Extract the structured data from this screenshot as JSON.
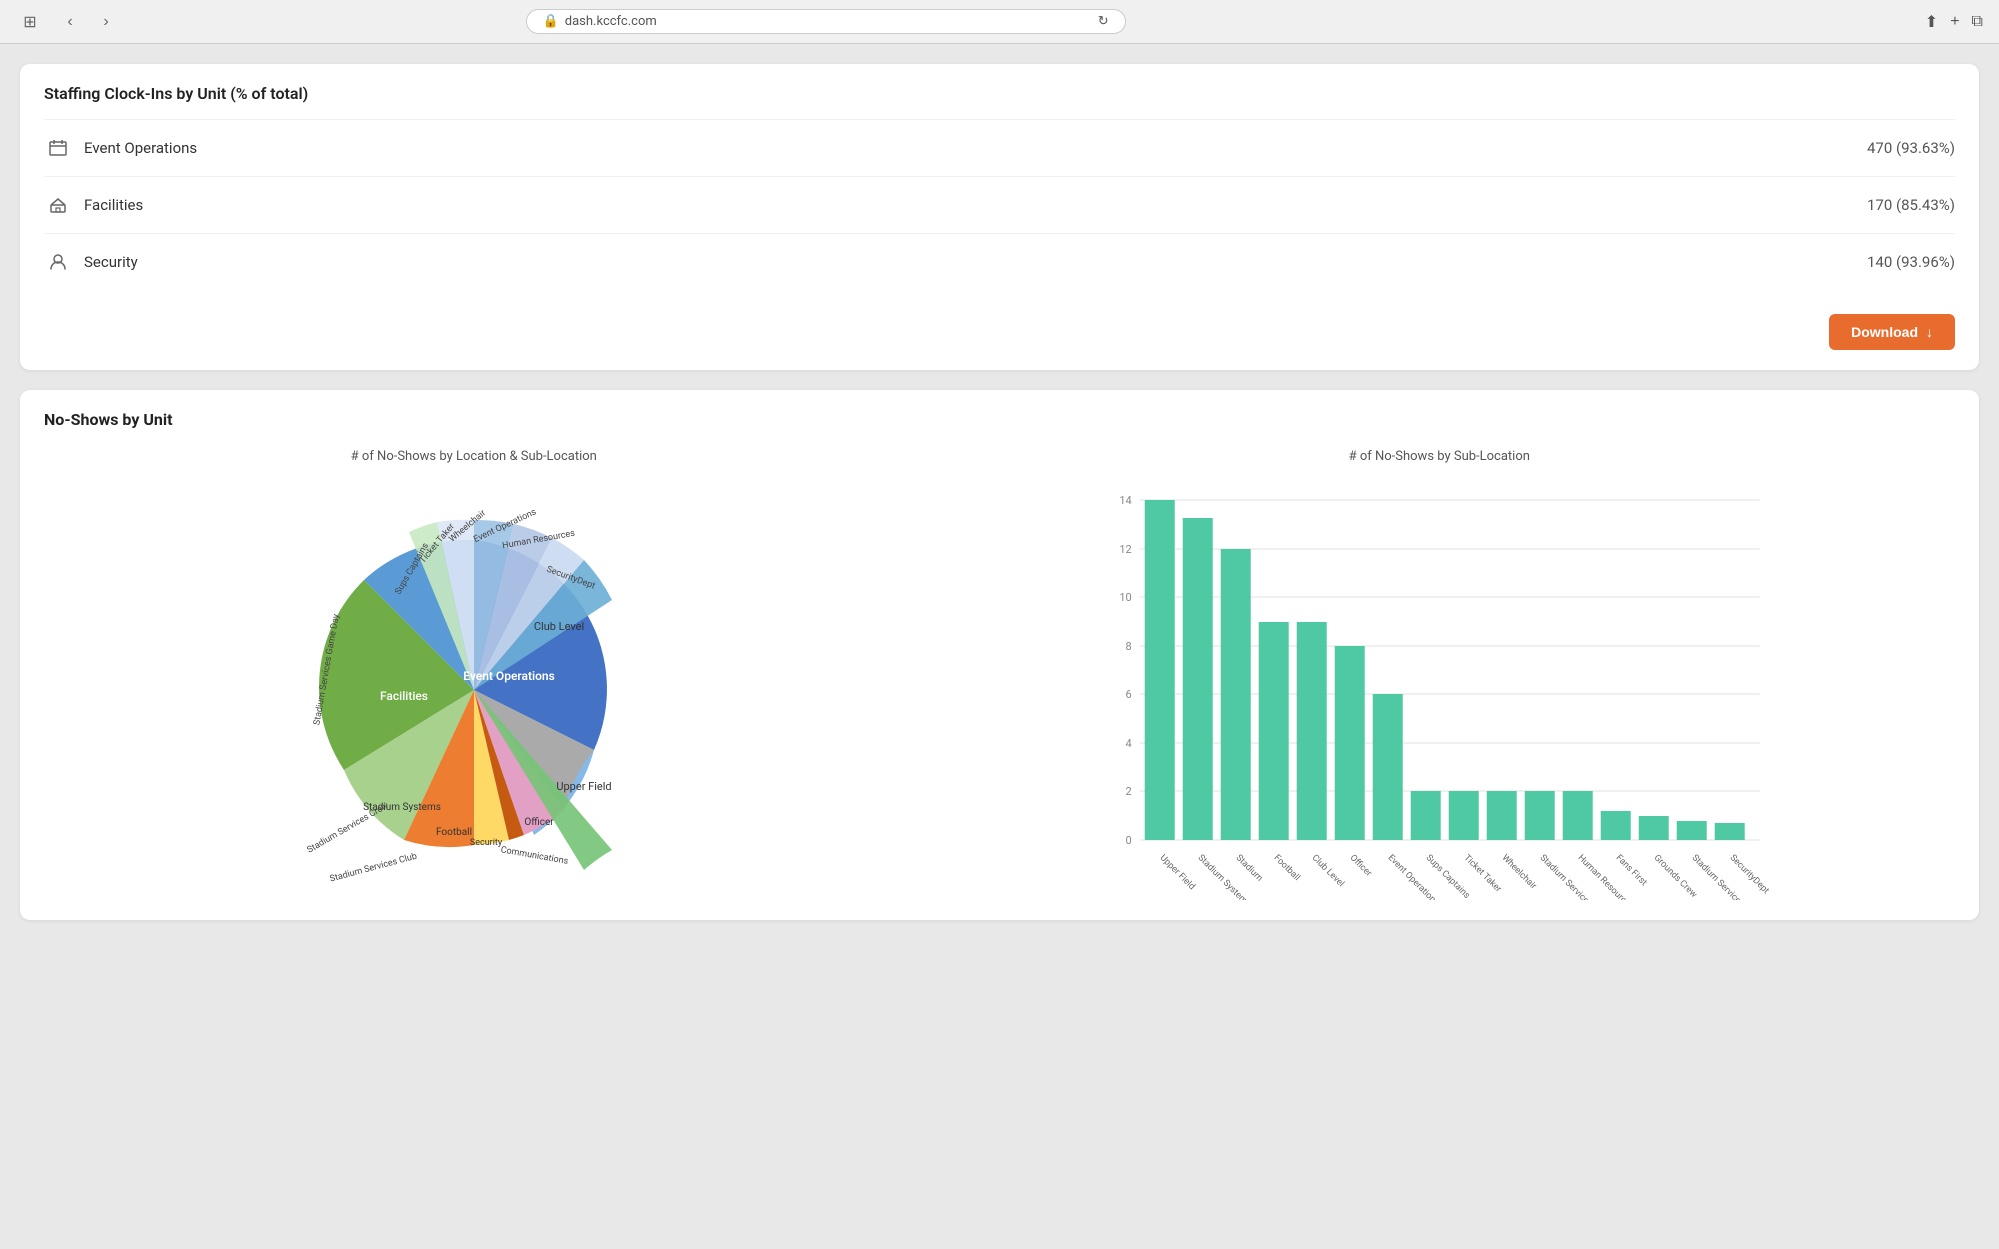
{
  "browser": {
    "url": "dash.kccfc.com",
    "lock_icon": "🔒",
    "reload_icon": "↻",
    "share_icon": "⬆",
    "new_tab_icon": "+",
    "windows_icon": "⧉",
    "back_icon": "‹",
    "forward_icon": "›",
    "windows_grid_icon": "⊞"
  },
  "staffing_section": {
    "title": "Staffing Clock-Ins by Unit (% of total)",
    "rows": [
      {
        "icon": "calendar",
        "name": "Event Operations",
        "value": "470 (93.63%)"
      },
      {
        "icon": "tools",
        "name": "Facilities",
        "value": "170 (85.43%)"
      },
      {
        "icon": "person",
        "name": "Security",
        "value": "140 (93.96%)"
      }
    ],
    "download_label": "Download"
  },
  "noshows_section": {
    "title": "No-Shows by Unit",
    "pie_subtitle": "# of No-Shows by Location & Sub-Location",
    "bar_subtitle": "# of No-Shows by Sub-Location",
    "bar_data": [
      {
        "label": "Upper Field",
        "value": 14
      },
      {
        "label": "Stadium Systems",
        "value": 13
      },
      {
        "label": "Stadium Systems",
        "value": 12
      },
      {
        "label": "Football",
        "value": 9
      },
      {
        "label": "Club Level",
        "value": 9
      },
      {
        "label": "Officer",
        "value": 8
      },
      {
        "label": "Event Operations",
        "value": 6
      },
      {
        "label": "Sups Captains",
        "value": 2
      },
      {
        "label": "Ticket Taker",
        "value": 2
      },
      {
        "label": "Wheelchair",
        "value": 2
      },
      {
        "label": "Stadium Services Club",
        "value": 2
      },
      {
        "label": "Human Resources",
        "value": 2
      },
      {
        "label": "Fans First",
        "value": 1.2
      },
      {
        "label": "Grounds Crew",
        "value": 1
      },
      {
        "label": "Stadium Services Field/Upper",
        "value": 0.8
      },
      {
        "label": "SecurityDept",
        "value": 0.7
      }
    ],
    "bar_max": 14,
    "bar_color": "#4ec9a3",
    "y_ticks": [
      0,
      2,
      4,
      6,
      8,
      10,
      12,
      14
    ]
  },
  "pie_segments": [
    {
      "label": "Club Level",
      "color": "#5b9bd5",
      "pct": 13
    },
    {
      "label": "Event Operations",
      "color": "#4472c4",
      "pct": 28
    },
    {
      "label": "Upper Field",
      "color": "#85b9e9",
      "pct": 15
    },
    {
      "label": "Facilities",
      "color": "#70ad47",
      "pct": 22
    },
    {
      "label": "Stadium Systems",
      "color": "#a9d18e",
      "pct": 8
    },
    {
      "label": "Football",
      "color": "#ed7d31",
      "pct": 7
    },
    {
      "label": "Security",
      "color": "#ffd966",
      "pct": 4
    },
    {
      "label": "Officer",
      "color": "#e2a0c4",
      "pct": 5
    },
    {
      "label": "Communications",
      "color": "#c55a11",
      "pct": 2
    },
    {
      "label": "Human Resources",
      "color": "#70ad47",
      "pct": 1.5
    },
    {
      "label": "SecurityDept",
      "color": "#aaa",
      "pct": 1
    },
    {
      "label": "Sups Captains",
      "color": "#9dc3e6",
      "pct": 2
    },
    {
      "label": "Ticket Taker",
      "color": "#b4c7e7",
      "pct": 1.5
    },
    {
      "label": "Wheelchair",
      "color": "#c9d9f0",
      "pct": 1.5
    },
    {
      "label": "Fans First",
      "color": "#dce6f5",
      "pct": 1
    },
    {
      "label": "Event Operations outer",
      "color": "#6baed6",
      "pct": 1.5
    },
    {
      "label": "Stadium Services Game Day",
      "color": "#74c476",
      "pct": 4
    },
    {
      "label": "Stadium Services Crew",
      "color": "#a1d99b",
      "pct": 2
    },
    {
      "label": "Stadium Services Club",
      "color": "#c7e9c0",
      "pct": 1.5
    }
  ]
}
